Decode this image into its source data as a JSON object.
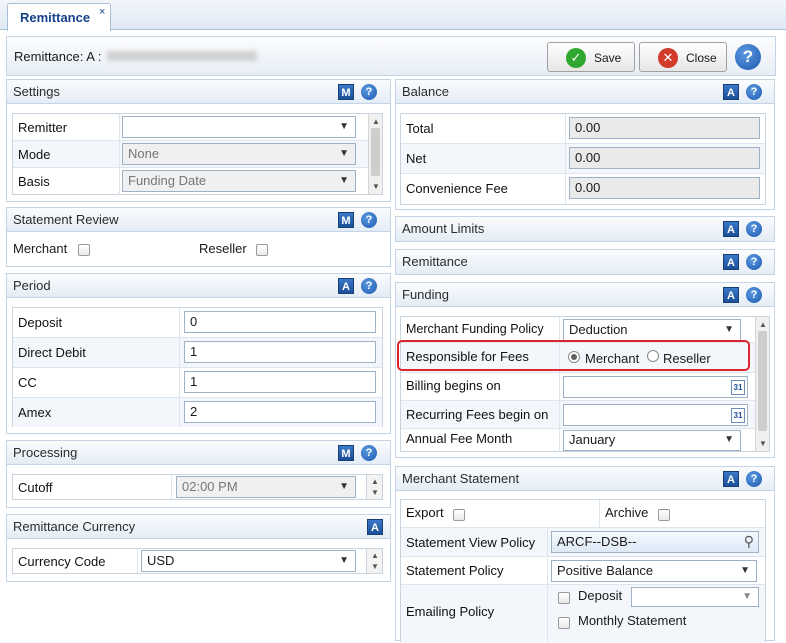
{
  "tab": {
    "label": "Remittance",
    "close": "×"
  },
  "header": {
    "title": "Remittance: A :",
    "save_label": "Save",
    "close_label": "Close",
    "help": "?"
  },
  "settings": {
    "title": "Settings",
    "badge": "M",
    "rows": [
      {
        "label": "Remitter",
        "value": ""
      },
      {
        "label": "Mode",
        "value": "None"
      },
      {
        "label": "Basis",
        "value": "Funding Date"
      }
    ]
  },
  "statement_review": {
    "title": "Statement Review",
    "badge": "M",
    "merchant_label": "Merchant",
    "reseller_label": "Reseller"
  },
  "period": {
    "title": "Period",
    "badge": "A",
    "rows": [
      {
        "label": "Deposit",
        "value": "0"
      },
      {
        "label": "Direct Debit",
        "value": "1"
      },
      {
        "label": "CC",
        "value": "1"
      },
      {
        "label": "Amex",
        "value": "2"
      }
    ]
  },
  "processing": {
    "title": "Processing",
    "badge": "M",
    "cutoff_label": "Cutoff",
    "cutoff_value": "02:00 PM"
  },
  "remittance_currency": {
    "title": "Remittance Currency",
    "badge": "A",
    "currency_label": "Currency Code",
    "currency_value": "USD"
  },
  "balance": {
    "title": "Balance",
    "badge": "A",
    "rows": [
      {
        "label": "Total",
        "value": "0.00"
      },
      {
        "label": "Net",
        "value": "0.00"
      },
      {
        "label": "Convenience Fee",
        "value": "0.00"
      }
    ]
  },
  "amount_limits": {
    "title": "Amount Limits",
    "badge": "A"
  },
  "remittance": {
    "title": "Remittance",
    "badge": "A"
  },
  "funding": {
    "title": "Funding",
    "badge": "A",
    "policy_label": "Merchant Funding Policy",
    "policy_value": "Deduction",
    "fees_label": "Responsible for Fees",
    "fees_merchant": "Merchant",
    "fees_reseller": "Reseller",
    "billing_label": "Billing begins on",
    "billing_value": "",
    "recurring_label": "Recurring Fees begin on",
    "recurring_value": "",
    "annual_label": "Annual Fee Month",
    "annual_value": "January"
  },
  "merchant_statement": {
    "title": "Merchant Statement",
    "badge": "A",
    "export_label": "Export",
    "archive_label": "Archive",
    "view_policy_label": "Statement View Policy",
    "view_policy_value": "ARCF--DSB--",
    "policy_label": "Statement Policy",
    "policy_value": "Positive Balance",
    "emailing_label": "Emailing Policy",
    "deposit_label": "Deposit",
    "deposit_value": "",
    "monthly_label": "Monthly Statement"
  },
  "colors": {
    "accent": "#15428b",
    "highlight": "#e0242c",
    "save_green": "#2fa82f",
    "close_red": "#d23a2a"
  }
}
